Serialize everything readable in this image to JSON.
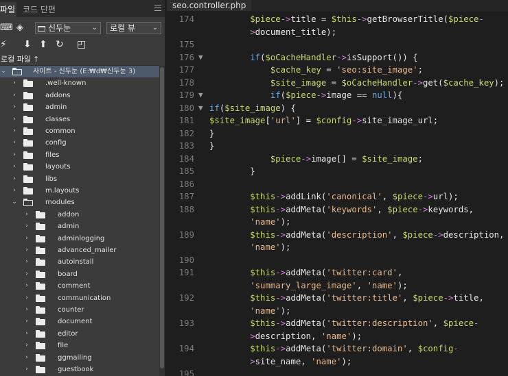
{
  "panel": {
    "tabs": [
      "파일",
      "코드 단편"
    ],
    "site_select": "신두눈",
    "view_select": "로컬 뷰",
    "local_files_label": "로컬 파일",
    "tree": [
      {
        "label": "사이트 - 신두눈 (E:₩d₩신두눈 3)",
        "depth": 0,
        "open": true,
        "selected": true
      },
      {
        "label": ".well-known",
        "depth": 1
      },
      {
        "label": "addons",
        "depth": 1
      },
      {
        "label": "admin",
        "depth": 1
      },
      {
        "label": "classes",
        "depth": 1
      },
      {
        "label": "common",
        "depth": 1
      },
      {
        "label": "config",
        "depth": 1
      },
      {
        "label": "files",
        "depth": 1
      },
      {
        "label": "layouts",
        "depth": 1
      },
      {
        "label": "libs",
        "depth": 1
      },
      {
        "label": "m.layouts",
        "depth": 1
      },
      {
        "label": "modules",
        "depth": 1,
        "open": true
      },
      {
        "label": "addon",
        "depth": 2
      },
      {
        "label": "admin",
        "depth": 2
      },
      {
        "label": "adminlogging",
        "depth": 2
      },
      {
        "label": "advanced_mailer",
        "depth": 2
      },
      {
        "label": "autoinstall",
        "depth": 2
      },
      {
        "label": "board",
        "depth": 2
      },
      {
        "label": "comment",
        "depth": 2
      },
      {
        "label": "communication",
        "depth": 2
      },
      {
        "label": "counter",
        "depth": 2
      },
      {
        "label": "document",
        "depth": 2
      },
      {
        "label": "editor",
        "depth": 2
      },
      {
        "label": "file",
        "depth": 2
      },
      {
        "label": "ggmailing",
        "depth": 2
      },
      {
        "label": "guestbook",
        "depth": 2
      }
    ]
  },
  "editor": {
    "tab_label": "seo.controller.php",
    "colors": {
      "keyword": "#5da9f2",
      "variable": "#c6db70",
      "string": "#e8b98c",
      "arrow": "#d77ee0"
    },
    "lines": [
      {
        "no": "174",
        "tokens": [
          [
            "",
            "        "
          ],
          [
            "v",
            "$piece"
          ],
          [
            "a",
            "->"
          ],
          [
            "",
            "title = "
          ],
          [
            "v",
            "$this"
          ],
          [
            "a",
            "->"
          ],
          [
            "",
            "getBrowserTitle("
          ],
          [
            "v",
            "$piece"
          ],
          [
            "a",
            "-"
          ]
        ]
      },
      {
        "no": "",
        "tokens": [
          [
            "",
            "        "
          ],
          [
            "a",
            ">"
          ],
          [
            "",
            "document_title);"
          ]
        ]
      },
      {
        "no": "175",
        "tokens": []
      },
      {
        "no": "176",
        "fold": true,
        "tokens": [
          [
            "",
            "        "
          ],
          [
            "k",
            "if"
          ],
          [
            "",
            "("
          ],
          [
            "v",
            "$oCacheHandler"
          ],
          [
            "a",
            "->"
          ],
          [
            "",
            "isSupport()) {"
          ]
        ]
      },
      {
        "no": "177",
        "tokens": [
          [
            "",
            "            "
          ],
          [
            "v",
            "$cache_key"
          ],
          [
            "",
            " = "
          ],
          [
            "s",
            "'seo:site_image'"
          ],
          [
            "",
            ";"
          ]
        ]
      },
      {
        "no": "178",
        "tokens": [
          [
            "",
            "            "
          ],
          [
            "v",
            "$site_image"
          ],
          [
            "",
            " = "
          ],
          [
            "v",
            "$oCacheHandler"
          ],
          [
            "a",
            "->"
          ],
          [
            "",
            "get("
          ],
          [
            "v",
            "$cache_key"
          ],
          [
            "",
            ");"
          ]
        ]
      },
      {
        "no": "179",
        "fold": true,
        "tokens": [
          [
            "",
            "            "
          ],
          [
            "k",
            "if"
          ],
          [
            "",
            "("
          ],
          [
            "v",
            "$piece"
          ],
          [
            "a",
            "->"
          ],
          [
            "",
            "image == "
          ],
          [
            "k",
            "null"
          ],
          [
            "",
            "){"
          ]
        ]
      },
      {
        "no": "180",
        "fold": true,
        "tokens": [
          [
            "k",
            "if"
          ],
          [
            "",
            "("
          ],
          [
            "v",
            "$site_image"
          ],
          [
            "",
            ") {"
          ]
        ]
      },
      {
        "no": "181",
        "tokens": [
          [
            "v",
            "$site_image"
          ],
          [
            "",
            "["
          ],
          [
            "s",
            "'url'"
          ],
          [
            "",
            "] = "
          ],
          [
            "v",
            "$config"
          ],
          [
            "a",
            "->"
          ],
          [
            "",
            "site_image_url;"
          ]
        ]
      },
      {
        "no": "182",
        "tokens": [
          [
            "",
            "}"
          ]
        ]
      },
      {
        "no": "183",
        "tokens": [
          [
            "",
            "}"
          ]
        ]
      },
      {
        "no": "184",
        "tokens": [
          [
            "",
            "            "
          ],
          [
            "v",
            "$piece"
          ],
          [
            "a",
            "->"
          ],
          [
            "",
            "image[] = "
          ],
          [
            "v",
            "$site_image"
          ],
          [
            "",
            ";"
          ]
        ]
      },
      {
        "no": "185",
        "tokens": [
          [
            "",
            "        }"
          ]
        ]
      },
      {
        "no": "186",
        "tokens": []
      },
      {
        "no": "187",
        "tokens": [
          [
            "",
            "        "
          ],
          [
            "v",
            "$this"
          ],
          [
            "a",
            "->"
          ],
          [
            "",
            "addLink("
          ],
          [
            "s",
            "'canonical'"
          ],
          [
            "",
            ", "
          ],
          [
            "v",
            "$piece"
          ],
          [
            "a",
            "->"
          ],
          [
            "",
            "url);"
          ]
        ]
      },
      {
        "no": "188",
        "tokens": [
          [
            "",
            "        "
          ],
          [
            "v",
            "$this"
          ],
          [
            "a",
            "->"
          ],
          [
            "",
            "addMeta("
          ],
          [
            "s",
            "'keywords'"
          ],
          [
            "",
            ", "
          ],
          [
            "v",
            "$piece"
          ],
          [
            "a",
            "->"
          ],
          [
            "",
            "keywords,"
          ]
        ]
      },
      {
        "no": "",
        "tokens": [
          [
            "",
            "        "
          ],
          [
            "s",
            "'name'"
          ],
          [
            "",
            ");"
          ]
        ]
      },
      {
        "no": "189",
        "tokens": [
          [
            "",
            "        "
          ],
          [
            "v",
            "$this"
          ],
          [
            "a",
            "->"
          ],
          [
            "",
            "addMeta("
          ],
          [
            "s",
            "'description'"
          ],
          [
            "",
            ", "
          ],
          [
            "v",
            "$piece"
          ],
          [
            "a",
            "->"
          ],
          [
            "",
            "description,"
          ]
        ]
      },
      {
        "no": "",
        "tokens": [
          [
            "",
            "        "
          ],
          [
            "s",
            "'name'"
          ],
          [
            "",
            ");"
          ]
        ]
      },
      {
        "no": "190",
        "tokens": []
      },
      {
        "no": "191",
        "tokens": [
          [
            "",
            "        "
          ],
          [
            "v",
            "$this"
          ],
          [
            "a",
            "->"
          ],
          [
            "",
            "addMeta("
          ],
          [
            "s",
            "'twitter:card'"
          ],
          [
            "",
            ","
          ]
        ]
      },
      {
        "no": "",
        "tokens": [
          [
            "",
            "        "
          ],
          [
            "s",
            "'summary_large_image'"
          ],
          [
            "",
            ", "
          ],
          [
            "s",
            "'name'"
          ],
          [
            "",
            ");"
          ]
        ]
      },
      {
        "no": "192",
        "tokens": [
          [
            "",
            "        "
          ],
          [
            "v",
            "$this"
          ],
          [
            "a",
            "->"
          ],
          [
            "",
            "addMeta("
          ],
          [
            "s",
            "'twitter:title'"
          ],
          [
            "",
            ", "
          ],
          [
            "v",
            "$piece"
          ],
          [
            "a",
            "->"
          ],
          [
            "",
            "title,"
          ]
        ]
      },
      {
        "no": "",
        "tokens": [
          [
            "",
            "        "
          ],
          [
            "s",
            "'name'"
          ],
          [
            "",
            ");"
          ]
        ]
      },
      {
        "no": "193",
        "tokens": [
          [
            "",
            "        "
          ],
          [
            "v",
            "$this"
          ],
          [
            "a",
            "->"
          ],
          [
            "",
            "addMeta("
          ],
          [
            "s",
            "'twitter:description'"
          ],
          [
            "",
            ", "
          ],
          [
            "v",
            "$piece"
          ],
          [
            "a",
            "-"
          ]
        ]
      },
      {
        "no": "",
        "tokens": [
          [
            "",
            "        "
          ],
          [
            "a",
            ">"
          ],
          [
            "",
            "description, "
          ],
          [
            "s",
            "'name'"
          ],
          [
            "",
            ");"
          ]
        ]
      },
      {
        "no": "194",
        "tokens": [
          [
            "",
            "        "
          ],
          [
            "v",
            "$this"
          ],
          [
            "a",
            "->"
          ],
          [
            "",
            "addMeta("
          ],
          [
            "s",
            "'twitter:domain'"
          ],
          [
            "",
            ", "
          ],
          [
            "v",
            "$config"
          ],
          [
            "a",
            "-"
          ]
        ]
      },
      {
        "no": "",
        "tokens": [
          [
            "",
            "        "
          ],
          [
            "a",
            ">"
          ],
          [
            "",
            "site_name, "
          ],
          [
            "s",
            "'name'"
          ],
          [
            "",
            ");"
          ]
        ]
      },
      {
        "no": "195",
        "tokens": []
      }
    ]
  }
}
